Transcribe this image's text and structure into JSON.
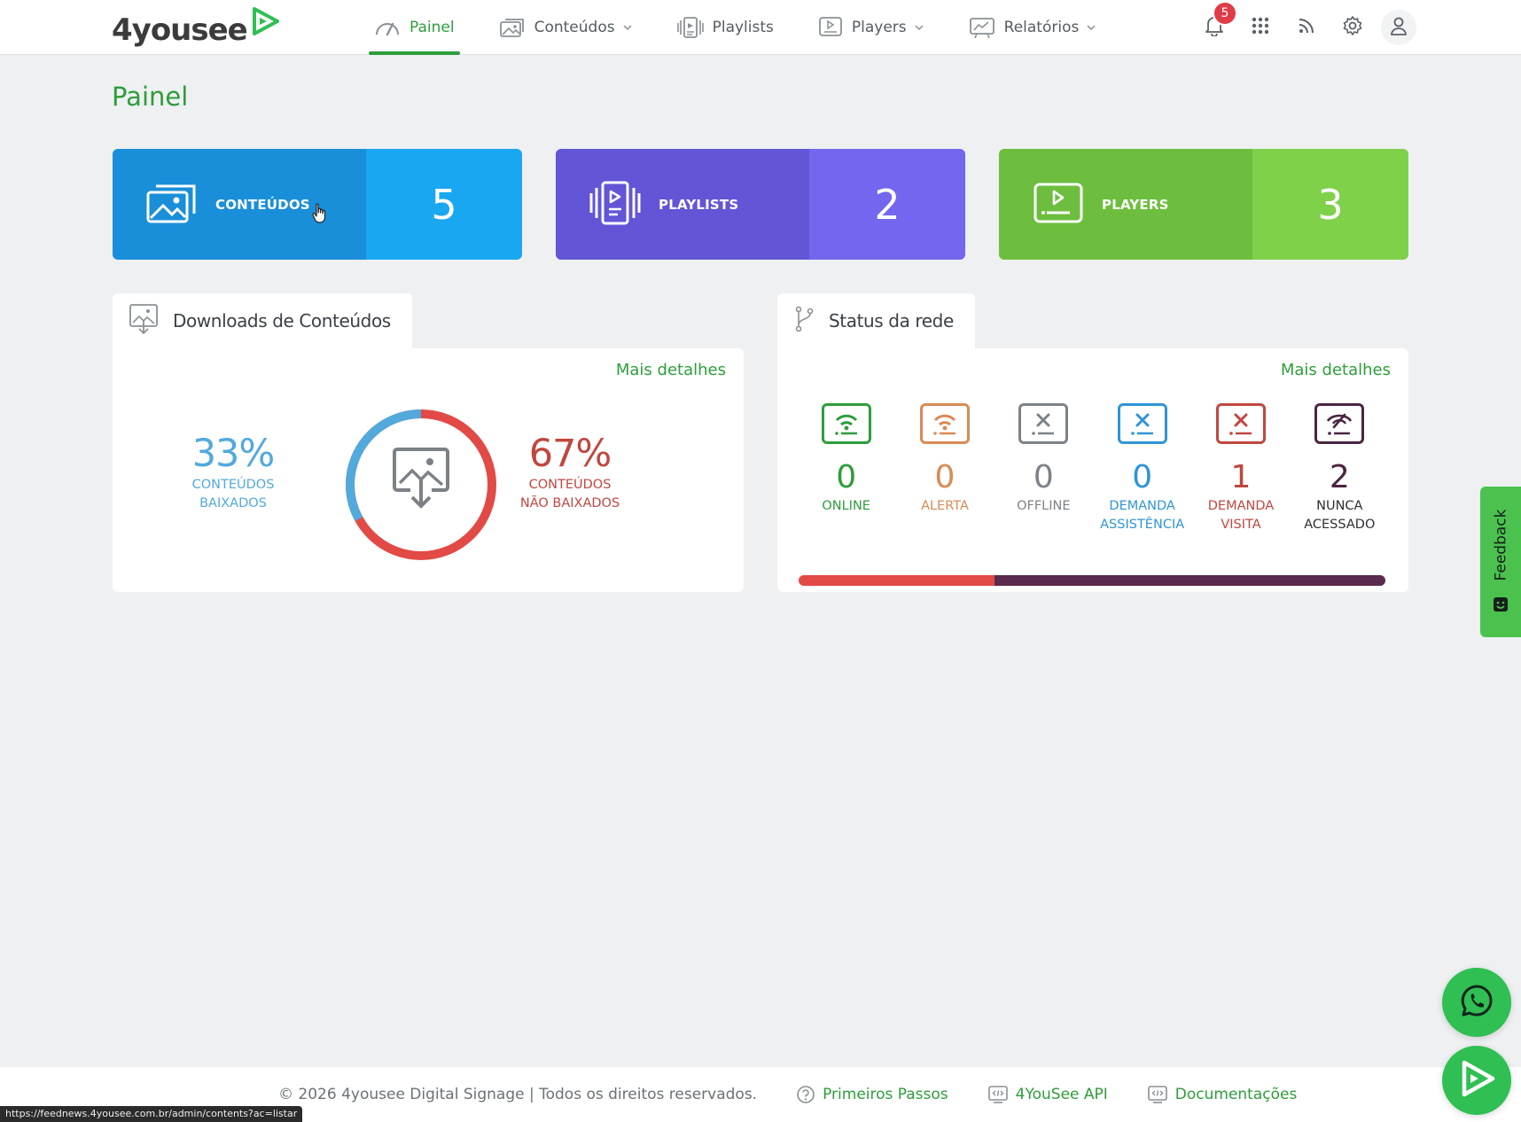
{
  "header": {
    "logo_text": "4yousee",
    "nav": [
      {
        "label": "Painel",
        "icon": "gauge-icon",
        "active": true,
        "dropdown": false
      },
      {
        "label": "Conteúdos",
        "icon": "images-icon",
        "active": false,
        "dropdown": true
      },
      {
        "label": "Playlists",
        "icon": "playlist-icon",
        "active": false,
        "dropdown": false
      },
      {
        "label": "Players",
        "icon": "player-screen-icon",
        "active": false,
        "dropdown": true
      },
      {
        "label": "Relatórios",
        "icon": "report-chart-icon",
        "active": false,
        "dropdown": true
      }
    ],
    "notification_count": "5",
    "icons": [
      "bell-icon",
      "apps-grid-icon",
      "rss-icon",
      "gear-icon",
      "user-icon"
    ]
  },
  "page": {
    "title": "Painel"
  },
  "stat_cards": [
    {
      "label": "CONTEÚDOS",
      "value": "5",
      "icon": "images-icon"
    },
    {
      "label": "PLAYLISTS",
      "value": "2",
      "icon": "playlist-icon"
    },
    {
      "label": "PLAYERS",
      "value": "3",
      "icon": "player-screen-icon"
    }
  ],
  "downloads": {
    "title": "Downloads de Conteúdos",
    "more_link": "Mais detalhes",
    "downloaded_pct": "33%",
    "downloaded_label_1": "CONTEÚDOS",
    "downloaded_label_2": "BAIXADOS",
    "not_downloaded_pct": "67%",
    "not_downloaded_label_1": "CONTEÚDOS",
    "not_downloaded_label_2": "NÃO BAIXADOS",
    "downloaded_fraction": 0.33,
    "colors": {
      "downloaded": "#52a9dc",
      "not_downloaded": "#e24a46"
    }
  },
  "network": {
    "title": "Status da rede",
    "more_link": "Mais detalhes",
    "items": [
      {
        "count": "0",
        "label_1": "ONLINE",
        "label_2": "",
        "color": "#2e9d3b",
        "icon": "wifi-screen-icon"
      },
      {
        "count": "0",
        "label_1": "ALERTA",
        "label_2": "",
        "color": "#d98a55",
        "icon": "wifi-alert-screen-icon"
      },
      {
        "count": "0",
        "label_1": "OFFLINE",
        "label_2": "",
        "color": "#7d8288",
        "icon": "offline-screen-icon"
      },
      {
        "count": "0",
        "label_1": "DEMANDA",
        "label_2": "ASSISTÊNCIA",
        "color": "#2f95d6",
        "icon": "assist-screen-icon"
      },
      {
        "count": "1",
        "label_1": "DEMANDA",
        "label_2": "VISITA",
        "color": "#c0473f",
        "icon": "visit-screen-icon"
      },
      {
        "count": "2",
        "label_1": "NUNCA",
        "label_2": "ACESSADO",
        "color": "#4b2541",
        "icon": "never-accessed-screen-icon"
      }
    ],
    "bar_segments": [
      {
        "fraction": 0.3333,
        "color": "#e24a46"
      },
      {
        "fraction": 0.6667,
        "color": "#5a2b4d"
      }
    ]
  },
  "footer": {
    "copyright": "© 2026 4yousee Digital Signage | Todos os direitos reservados.",
    "links": [
      {
        "label": "Primeiros Passos",
        "icon": "help-circle-icon"
      },
      {
        "label": "4YouSee API",
        "icon": "code-window-icon"
      },
      {
        "label": "Documentações",
        "icon": "code-window-icon"
      }
    ]
  },
  "feedback_label": "Feedback",
  "status_url": "https://feednews.4yousee.com.br/admin/contents?ac=listar"
}
